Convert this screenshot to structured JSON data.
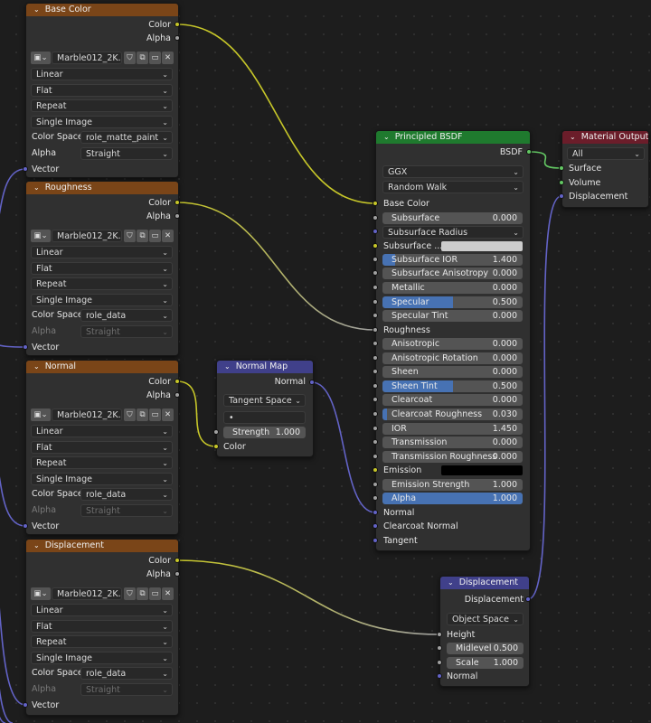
{
  "image_nodes": [
    {
      "title": "Base Color",
      "image_name": "Marble012_2K...",
      "interpolation": "Linear",
      "projection": "Flat",
      "extension": "Repeat",
      "source": "Single Image",
      "color_space_label": "Color Space",
      "color_space": "role_matte_paint",
      "alpha_label": "Alpha",
      "alpha_mode": "Straight",
      "alpha_disabled": false,
      "out_color": "Color",
      "out_alpha": "Alpha",
      "in_vector": "Vector"
    },
    {
      "title": "Roughness",
      "image_name": "Marble012_2K...",
      "interpolation": "Linear",
      "projection": "Flat",
      "extension": "Repeat",
      "source": "Single Image",
      "color_space_label": "Color Space",
      "color_space": "role_data",
      "alpha_label": "Alpha",
      "alpha_mode": "Straight",
      "alpha_disabled": true,
      "out_color": "Color",
      "out_alpha": "Alpha",
      "in_vector": "Vector"
    },
    {
      "title": "Normal",
      "image_name": "Marble012_2K...",
      "interpolation": "Linear",
      "projection": "Flat",
      "extension": "Repeat",
      "source": "Single Image",
      "color_space_label": "Color Space",
      "color_space": "role_data",
      "alpha_label": "Alpha",
      "alpha_mode": "Straight",
      "alpha_disabled": true,
      "out_color": "Color",
      "out_alpha": "Alpha",
      "in_vector": "Vector"
    },
    {
      "title": "Displacement",
      "image_name": "Marble012_2K...",
      "interpolation": "Linear",
      "projection": "Flat",
      "extension": "Repeat",
      "source": "Single Image",
      "color_space_label": "Color Space",
      "color_space": "role_data",
      "alpha_label": "Alpha",
      "alpha_mode": "Straight",
      "alpha_disabled": true,
      "out_color": "Color",
      "out_alpha": "Alpha",
      "in_vector": "Vector"
    }
  ],
  "normal_map": {
    "title": "Normal Map",
    "out_normal": "Normal",
    "space": "Tangent Space",
    "uv_map": "•",
    "strength_label": "Strength",
    "strength": "1.000",
    "in_color": "Color"
  },
  "principled": {
    "title": "Principled BSDF",
    "out_bsdf": "BSDF",
    "distribution": "GGX",
    "subsurface_method": "Random Walk",
    "base_color": "Base Color",
    "subsurface": {
      "label": "Subsurface",
      "value": "0.000",
      "fraction": 0
    },
    "subsurface_radius": "Subsurface Radius",
    "subsurface_color": "Subsurface ...",
    "subsurface_color_hex": "#cccccc",
    "fields": [
      {
        "label": "Subsurface IOR",
        "value": "1.400",
        "fraction": 0.09
      },
      {
        "label": "Subsurface Anisotropy",
        "value": "0.000",
        "fraction": 0
      },
      {
        "label": "Metallic",
        "value": "0.000",
        "fraction": 0
      },
      {
        "label": "Specular",
        "value": "0.500",
        "fraction": 0.5
      },
      {
        "label": "Specular Tint",
        "value": "0.000",
        "fraction": 0
      }
    ],
    "roughness": "Roughness",
    "fields2": [
      {
        "label": "Anisotropic",
        "value": "0.000",
        "fraction": 0
      },
      {
        "label": "Anisotropic Rotation",
        "value": "0.000",
        "fraction": 0
      },
      {
        "label": "Sheen",
        "value": "0.000",
        "fraction": 0
      },
      {
        "label": "Sheen Tint",
        "value": "0.500",
        "fraction": 0.5
      },
      {
        "label": "Clearcoat",
        "value": "0.000",
        "fraction": 0
      },
      {
        "label": "Clearcoat Roughness",
        "value": "0.030",
        "fraction": 0.03
      },
      {
        "label": "IOR",
        "value": "1.450",
        "fraction": 0
      },
      {
        "label": "Transmission",
        "value": "0.000",
        "fraction": 0
      },
      {
        "label": "Transmission Roughness",
        "value": "0.000",
        "fraction": 0
      }
    ],
    "emission": "Emission",
    "emission_color_hex": "#000000",
    "emission_strength": {
      "label": "Emission Strength",
      "value": "1.000",
      "fraction": 0
    },
    "alpha": {
      "label": "Alpha",
      "value": "1.000",
      "fraction": 1
    },
    "normal": "Normal",
    "clearcoat_normal": "Clearcoat Normal",
    "tangent": "Tangent"
  },
  "material_output": {
    "title": "Material Output",
    "target": "All",
    "surface": "Surface",
    "volume": "Volume",
    "displacement": "Displacement"
  },
  "displacement_node": {
    "title": "Displacement",
    "out_displacement": "Displacement",
    "space": "Object Space",
    "height": "Height",
    "midlevel_label": "Midlevel",
    "midlevel": "0.500",
    "scale_label": "Scale",
    "scale": "1.000",
    "normal": "Normal"
  },
  "colors": {
    "texture_header": "#7a4518",
    "vector_header": "#40408a",
    "shader_header": "#1f7a2e",
    "output_header": "#6b1d2a",
    "socket_color": "#c7c729",
    "socket_float": "#a1a1a1",
    "socket_vector": "#6363c7",
    "socket_shader": "#63c763",
    "slider_fill": "#4772b3"
  },
  "icons": [
    "chevron-down-icon",
    "image-icon",
    "fake-user-shield-icon",
    "duplicate-icon",
    "folder-icon",
    "close-icon"
  ]
}
